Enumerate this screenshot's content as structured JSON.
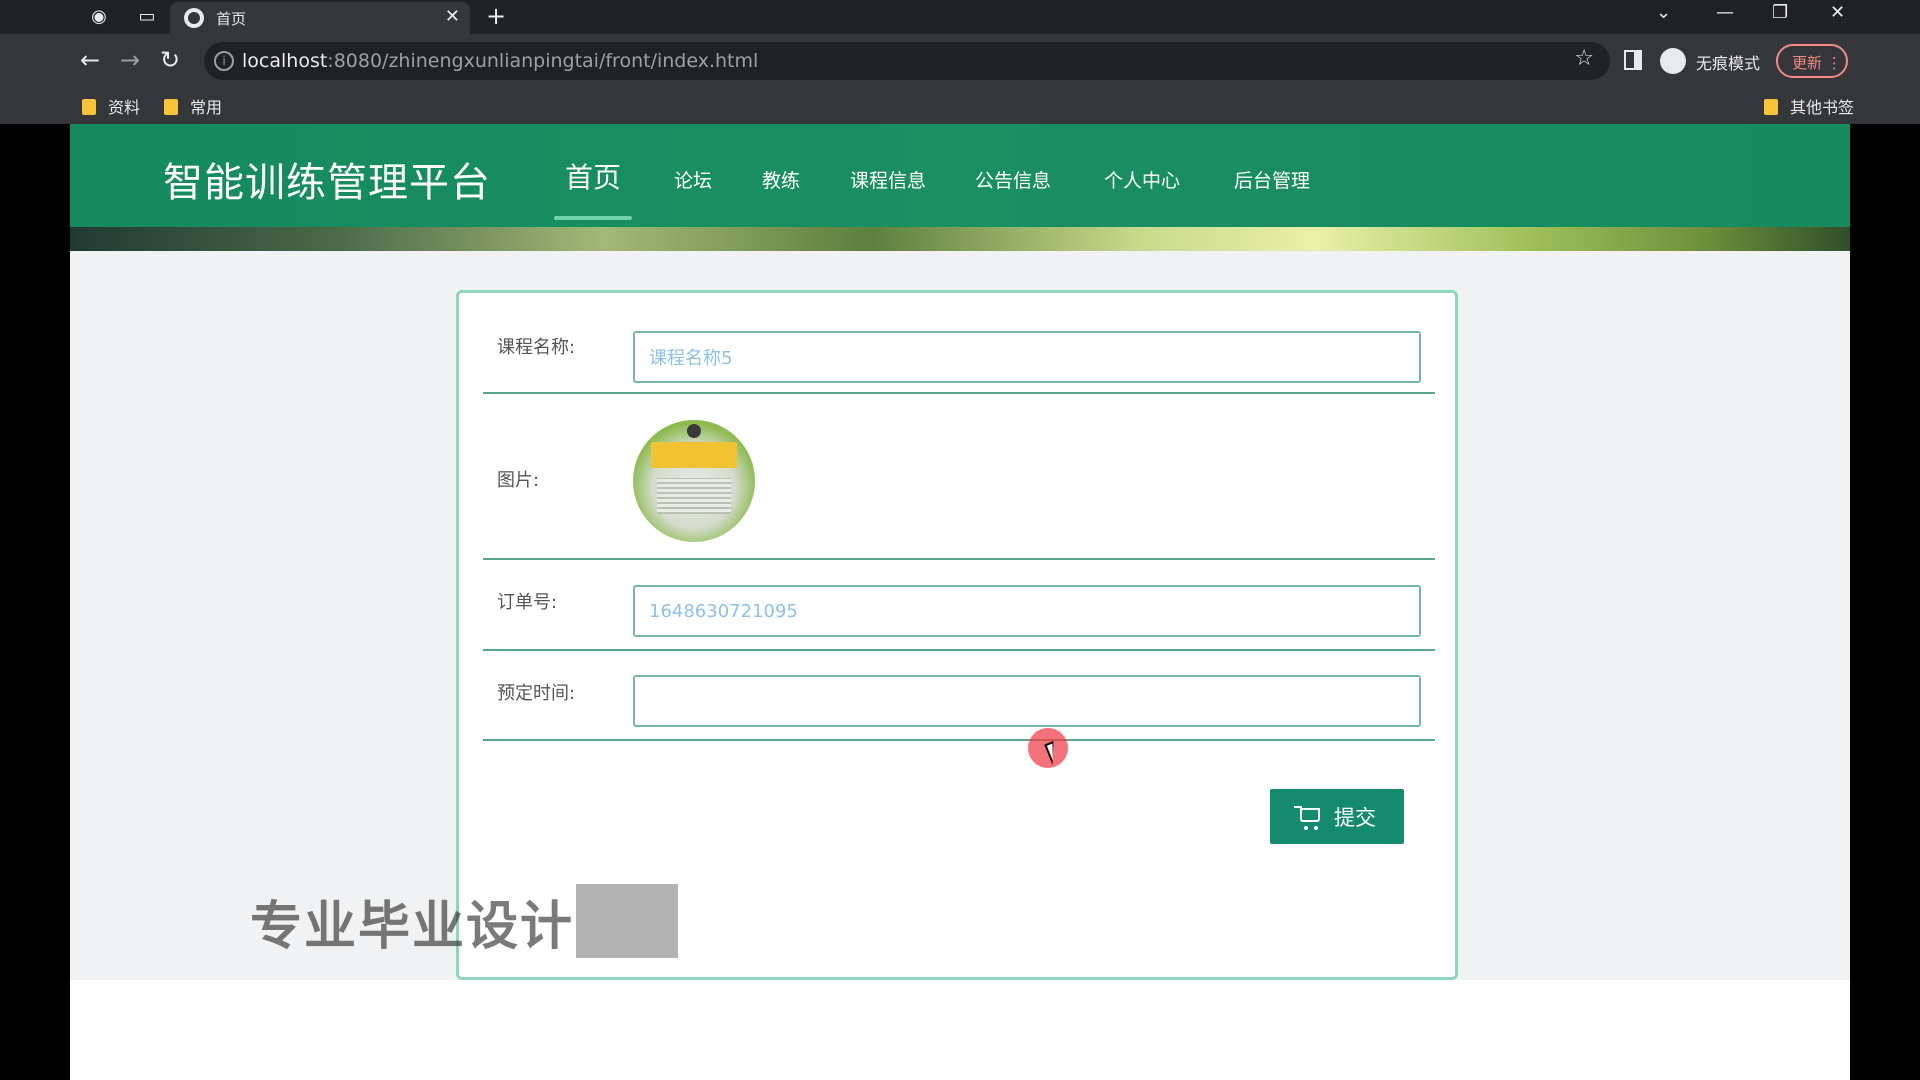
{
  "browser": {
    "tab_title": "首页",
    "url_host": "localhost",
    "url_rest": ":8080/zhinengxunlianpingtai/front/index.html",
    "incognito_label": "无痕模式",
    "update_label": "更新",
    "bookmarks": [
      "资料",
      "常用"
    ],
    "other_bookmarks": "其他书签"
  },
  "site": {
    "title": "智能训练管理平台",
    "nav": [
      "首页",
      "论坛",
      "教练",
      "课程信息",
      "公告信息",
      "个人中心",
      "后台管理"
    ],
    "active_nav": "首页"
  },
  "form": {
    "course_name_label": "课程名称:",
    "course_name_value": "课程名称5",
    "image_label": "图片:",
    "order_no_label": "订单号:",
    "order_no_value": "1648630721095",
    "booking_time_label": "预定时间:",
    "booking_time_value": "",
    "submit_label": "提交"
  },
  "watermark_text": "专业毕业设计",
  "colors": {
    "header_green": "#148a5e",
    "button_green": "#148a6e",
    "input_text": "#8ec1e8"
  }
}
